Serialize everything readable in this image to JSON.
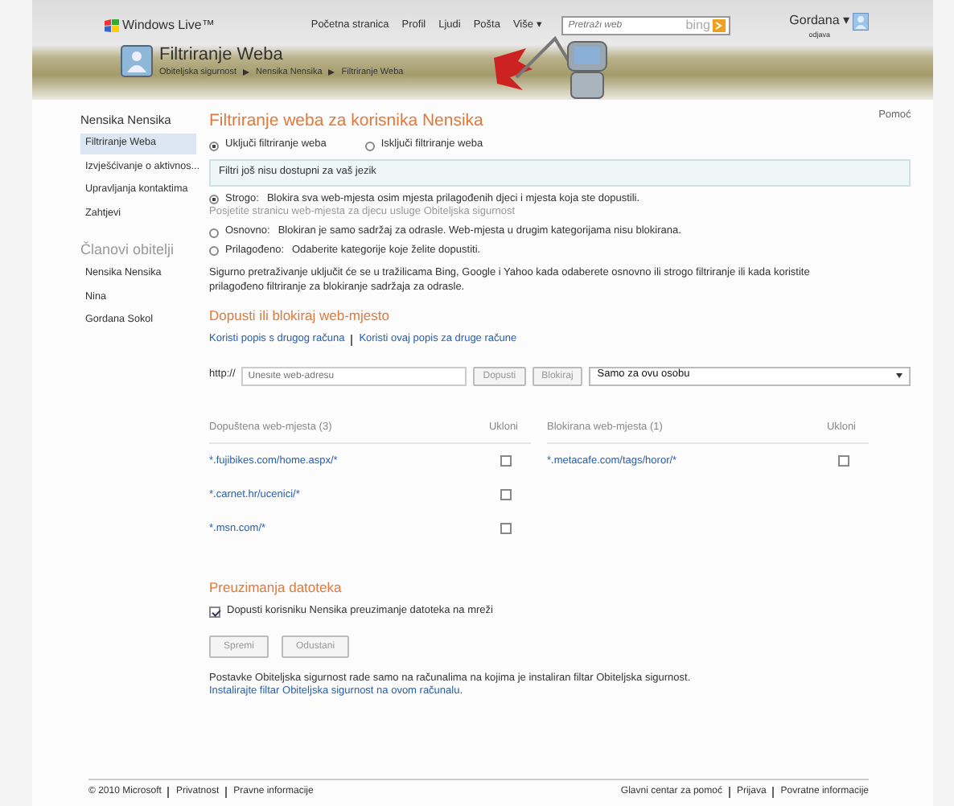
{
  "header": {
    "logo": "Windows Live™",
    "nav": [
      "Početna stranica",
      "Profil",
      "Ljudi",
      "Pošta",
      "Više ▾"
    ],
    "search_placeholder": "Pretraži web",
    "search_brand": "bing",
    "user": "Gordana ▾",
    "user_link": "odjava",
    "app_title": "Filtriranje Weba",
    "breadcrumb": [
      "Obiteljska sigurnost",
      "Nensika Nensika",
      "Filtriranje Weba"
    ]
  },
  "sidebar": {
    "heading": "Nensika Nensika",
    "items": [
      {
        "label": "Filtriranje Weba",
        "selected": true
      },
      {
        "label": "Izvješćivanje o aktivnos...",
        "selected": false
      },
      {
        "label": "Upravljanja kontaktima",
        "selected": false
      },
      {
        "label": "Zahtjevi",
        "selected": false
      }
    ],
    "members_heading": "Članovi obitelji",
    "members": [
      "Nensika Nensika",
      "Nina",
      "Gordana Sokol"
    ]
  },
  "main": {
    "title": "Filtriranje weba za korisnika Nensika",
    "help": "Pomoć",
    "toggle": [
      {
        "label": "Uključi filtriranje weba",
        "selected": true
      },
      {
        "label": "Isključi filtriranje weba",
        "selected": false
      }
    ],
    "notice": "Filtri još nisu dostupni za vaš jezik",
    "levels": [
      {
        "label": "Strogo:",
        "description": "Blokira sva web-mjesta osim mjesta prilagođenih djeci i mjesta koja ste dopustili.",
        "note": "Posjetite stranicu web-mjesta za djecu usluge Obiteljska sigurnost",
        "selected": true
      },
      {
        "label": "Osnovno:",
        "description": "Blokiran je samo sadržaj za odrasle. Web-mjesta u drugim kategorijama nisu blokirana.",
        "selected": false
      },
      {
        "label": "Prilagođeno:",
        "description": "Odaberite kategorije koje želite dopustiti.",
        "selected": false
      }
    ],
    "info": "Sigurno pretraživanje uključit će se u tražilicama Bing, Google i Yahoo kada odaberete osnovno ili strogo filtriranje ili kada koristite prilagođeno filtriranje za blokiranje sadržaja za odrasle.",
    "sites_title": "Dopusti ili blokiraj web-mjesto",
    "list_links": [
      "Koristi popis s drugog računa",
      "Koristi ovaj popis za druge račune"
    ],
    "url_prefix": "http://",
    "url_placeholder": "Unesite web-adresu",
    "allow_button": "Dopusti",
    "block_button": "Blokiraj",
    "scope": "Samo za ovu osobu",
    "allowed": {
      "heading": "Dopuštena web-mjesta (3)",
      "remove": "Ukloni",
      "items": [
        {
          "url": "*.fujibikes.com/home.aspx/*",
          "checked": false
        },
        {
          "url": "*.carnet.hr/ucenici/*",
          "checked": false
        },
        {
          "url": "*.msn.com/*",
          "checked": false
        }
      ]
    },
    "blocked": {
      "heading": "Blokirana web-mjesta (1)",
      "remove": "Ukloni",
      "items": [
        {
          "url": "*.metacafe.com/tags/horor/*",
          "checked": false
        }
      ]
    },
    "downloads_title": "Preuzimanja datoteka",
    "downloads_option": {
      "label": "Dopusti korisniku Nensika preuzimanje datoteka na mreži",
      "checked": true
    },
    "buttons": [
      {
        "label": "Spremi",
        "disabled": true
      },
      {
        "label": "Odustani",
        "disabled": true
      }
    ],
    "footnote": "Postavke Obiteljska sigurnost rade samo na računalima na kojima je instaliran filtar Obiteljska sigurnost.",
    "install_link": "Instalirajte filtar Obiteljska sigurnost na ovom računalu."
  },
  "footer": {
    "left": [
      "© 2010 Microsoft",
      "Privatnost",
      "Pravne informacije"
    ],
    "right": [
      "Glavni centar za pomoć",
      "Prijava",
      "Povratne informacije"
    ]
  }
}
